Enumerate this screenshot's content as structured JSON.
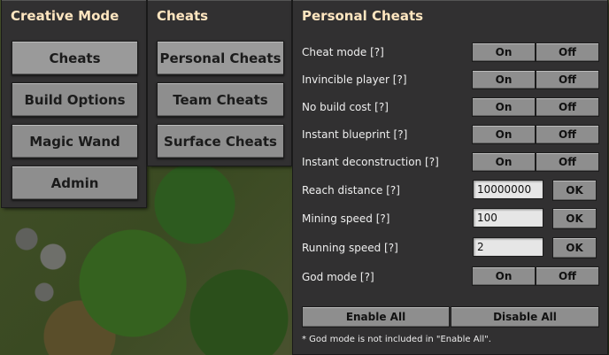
{
  "creative_mode": {
    "title": "Creative Mode",
    "buttons": [
      "Cheats",
      "Build Options",
      "Magic Wand",
      "Admin"
    ]
  },
  "cheats": {
    "title": "Cheats",
    "buttons": [
      "Personal Cheats",
      "Team Cheats",
      "Surface Cheats"
    ]
  },
  "personal_cheats": {
    "title": "Personal Cheats",
    "toggle_on_label": "On",
    "toggle_off_label": "Off",
    "ok_label": "OK",
    "rows": [
      {
        "label": "Cheat mode [?]"
      },
      {
        "label": "Invincible player [?]"
      },
      {
        "label": "No build cost [?]"
      },
      {
        "label": "Instant blueprint [?]"
      },
      {
        "label": "Instant deconstruction [?]"
      },
      {
        "label": "Reach distance [?]",
        "value": "10000000"
      },
      {
        "label": "Mining speed [?]",
        "value": "100"
      },
      {
        "label": "Running speed [?]",
        "value": "2"
      },
      {
        "label": "God mode [?]"
      }
    ],
    "enable_all_label": "Enable All",
    "disable_all_label": "Disable All",
    "footnote": "* God mode is not included in \"Enable All\"."
  }
}
